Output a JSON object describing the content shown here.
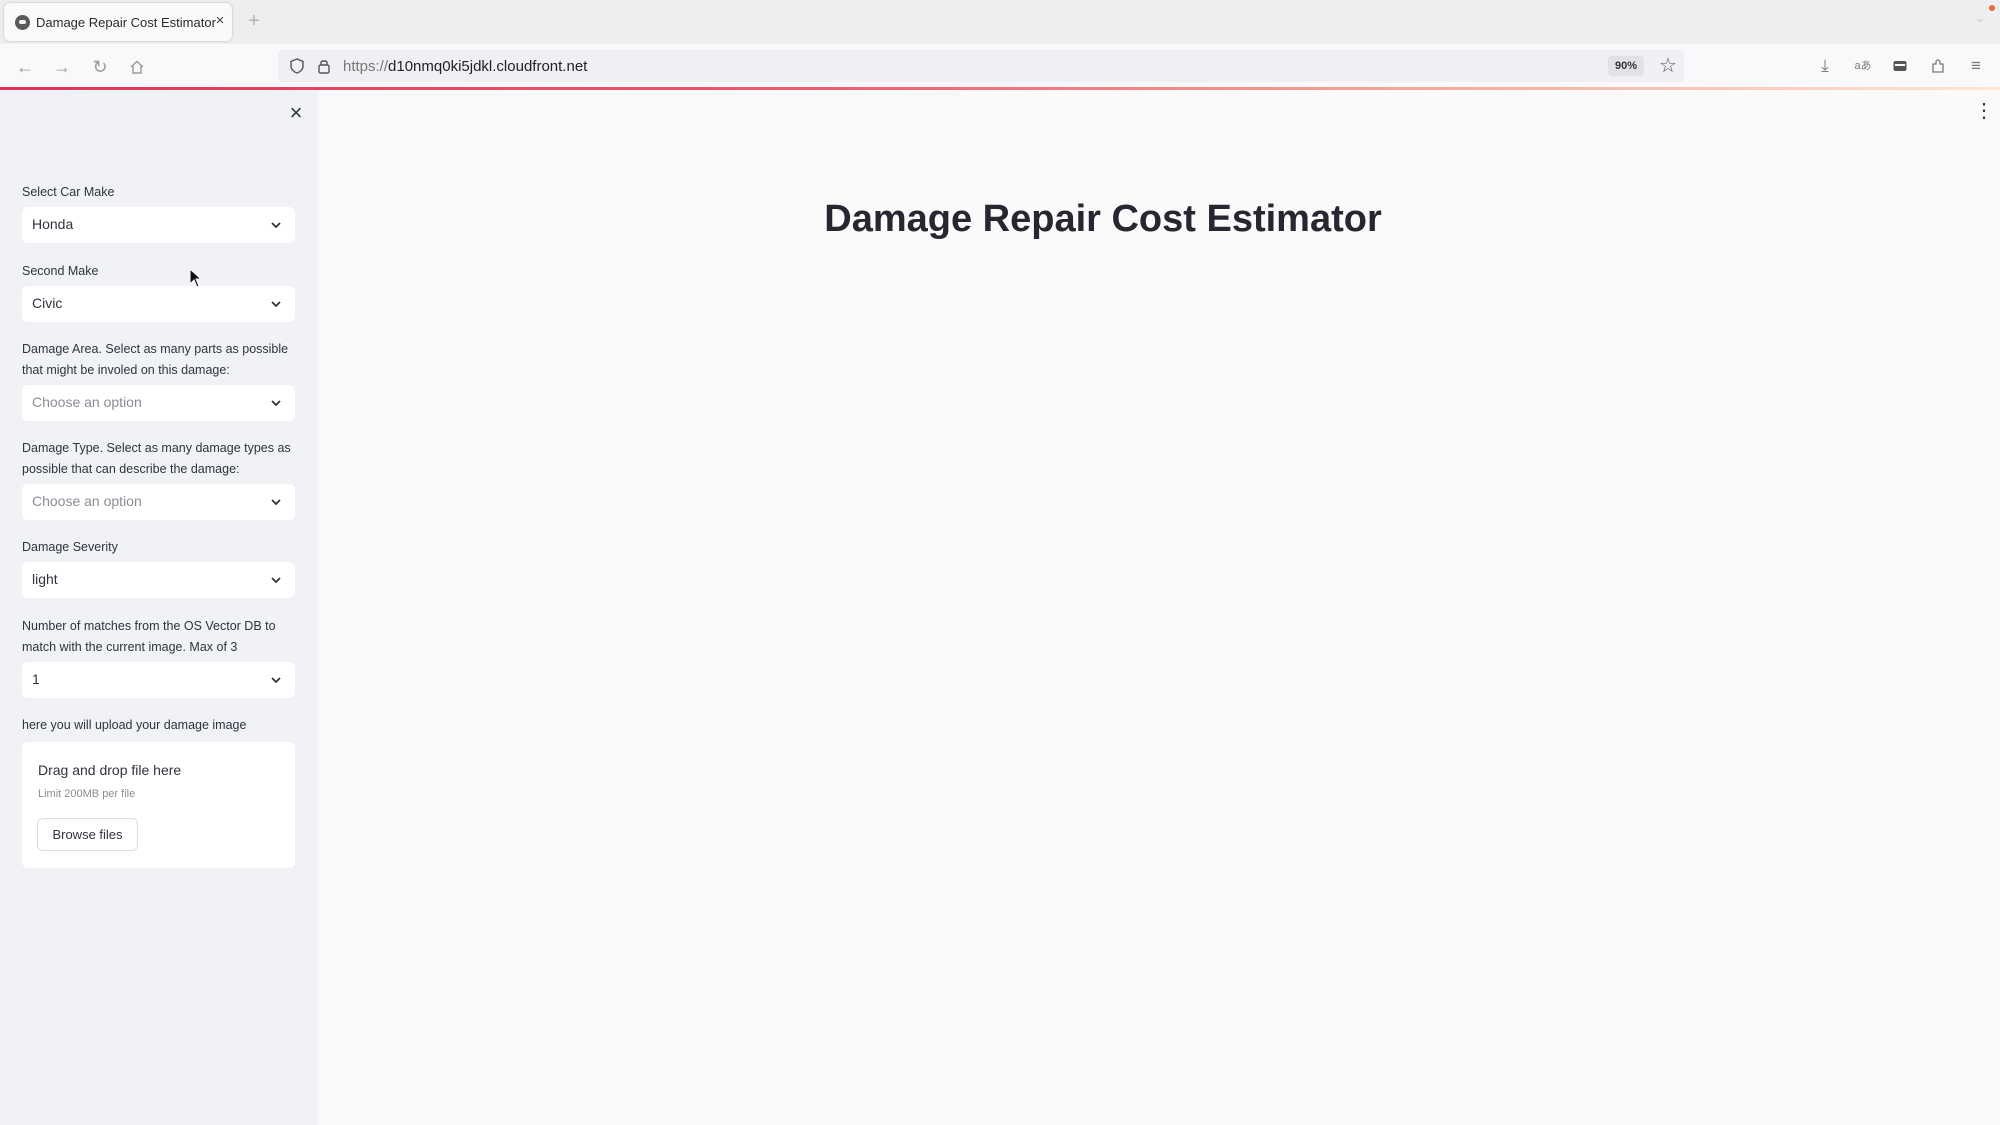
{
  "browser": {
    "tab_title": "Damage Repair Cost Estimator",
    "tab_close": "×",
    "new_tab": "+",
    "url_proto": "https://",
    "url_host": "d10nmq0ki5jdkl.cloudfront.net",
    "zoom": "90%",
    "icons": [
      "back-arrow-icon",
      "forward-arrow-icon",
      "reload-icon",
      "home-icon",
      "shield-icon",
      "lock-icon",
      "star-icon",
      "download-icon",
      "translate-icon",
      "container-icon",
      "extensions-icon",
      "menu-icon"
    ]
  },
  "sidebar": {
    "close_glyph": "×",
    "car_make": {
      "label": "Select Car Make",
      "value": "Honda"
    },
    "second_make": {
      "label": "Second Make",
      "value": "Civic"
    },
    "damage_area": {
      "label": "Damage Area. Select as many parts as possible that might be involed on this damage:",
      "placeholder": "Choose an option"
    },
    "damage_type": {
      "label": "Damage Type. Select as many damage types as possible that can describe the damage:",
      "placeholder": "Choose an option"
    },
    "damage_severity": {
      "label": "Damage Severity",
      "value": "light"
    },
    "matches": {
      "label": "Number of matches from the OS Vector DB to match with the current image. Max of 3",
      "value": "1"
    },
    "upload": {
      "label": "here you will upload your damage image",
      "title": "Drag and drop file here",
      "limit": "Limit 200MB per file",
      "button": "Browse files"
    }
  },
  "main": {
    "title": "Damage Repair Cost Estimator",
    "menu_glyph": "⋮"
  }
}
